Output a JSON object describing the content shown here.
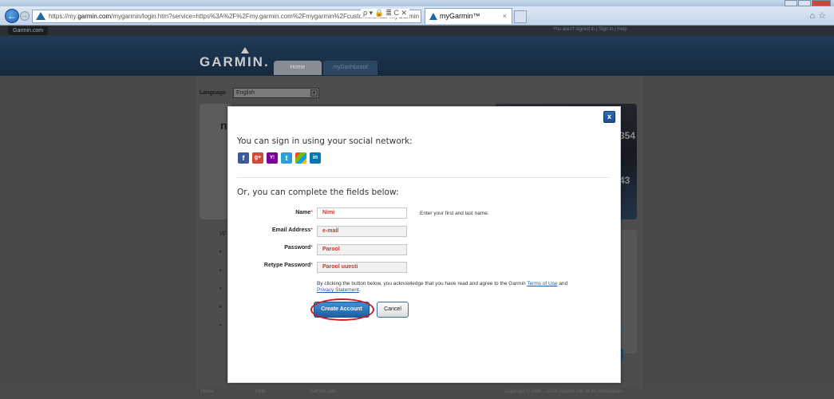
{
  "browser": {
    "url_prefix": "https://my.",
    "url_domain": "garmin.com",
    "url_rest": "/mygarmin/login.htm?service=https%3A%2F%2Fmy.garmin.com%2Fmygarmin%2Fcustomers%2FmyGarmin",
    "tab_title": "myGarmin™",
    "tab_close": "×",
    "addr_tools": "ρ ▾ 🔒 ≣ C ✕"
  },
  "site": {
    "garmin_com_link": "Garmin.com",
    "signin_msg": "You aren't signed in | Sign in | Help",
    "logo": "GARMIN.",
    "tabs": {
      "home": "Home",
      "mydashboard": "myDashboard"
    },
    "language_label": "Language",
    "language_value": "English",
    "banner_letter": "n",
    "banner_num1": "354",
    "banner_num2": "43",
    "bullets_heading": "W",
    "side_link": "One",
    "footer": {
      "home": "Home",
      "help": "Help",
      "garmin_com": "Garmin.com",
      "copyright": "Copyright © 1996 – 2014 Garmin Ltd. or its subsidiaries"
    }
  },
  "modal": {
    "close": "x",
    "social_heading": "You can sign in using your social network:",
    "social_icons": [
      {
        "name": "facebook",
        "glyph": "f"
      },
      {
        "name": "google-plus",
        "glyph": "g+"
      },
      {
        "name": "yahoo",
        "glyph": "Y!"
      },
      {
        "name": "twitter",
        "glyph": "t"
      },
      {
        "name": "windows-live",
        "glyph": ""
      },
      {
        "name": "linkedin",
        "glyph": "in"
      }
    ],
    "fields_heading": "Or, you can complete the fields below:",
    "fields": {
      "name": {
        "label": "Name",
        "value": "Nimi"
      },
      "email": {
        "label": "Email Address",
        "value": "e-mail"
      },
      "password": {
        "label": "Password",
        "value": "Parool"
      },
      "retype": {
        "label": "Retype Password",
        "value": "Parool uuesti"
      }
    },
    "required_mark": "*",
    "name_hint": "Enter your first and last name.",
    "consent_text": "By clicking the button below, you acknowledge that you have read and agree to the Garmin ",
    "terms_link": "Terms of Use",
    "and_text": " and",
    "privacy_link": "Privacy Statement",
    "period": ".",
    "create_button": "Create Account",
    "cancel_button": "Cancel"
  },
  "colors": {
    "accent_blue": "#1e5fa3",
    "annotation_red": "#c81d25",
    "field_text_red": "#c0392b"
  }
}
